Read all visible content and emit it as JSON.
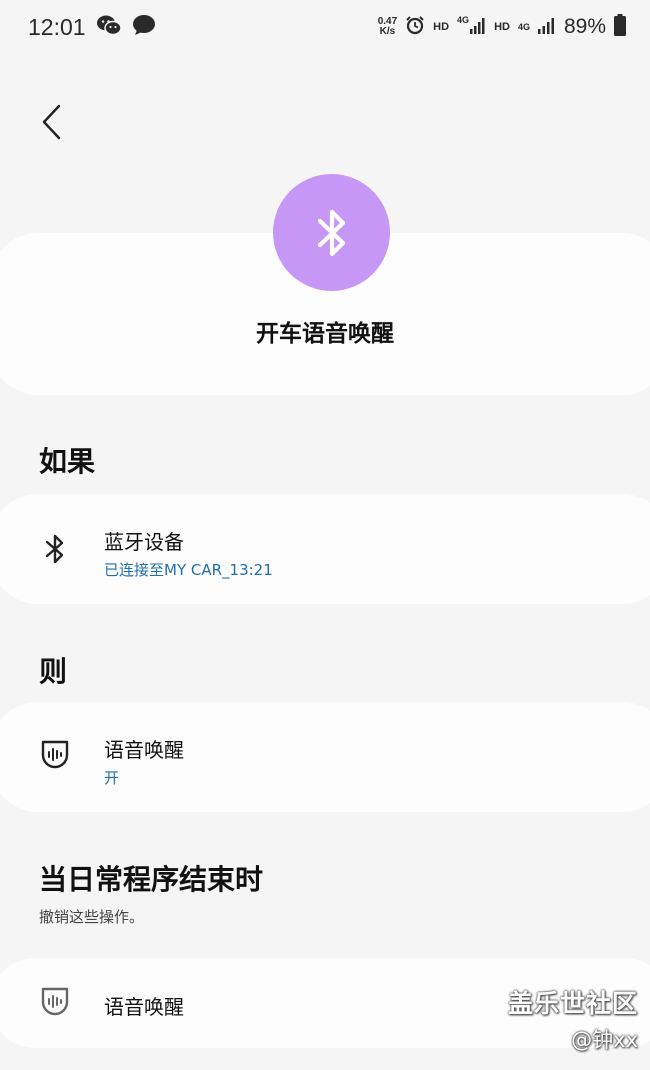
{
  "status_bar": {
    "time": "12:01",
    "netspeed_value": "0.47",
    "netspeed_unit": "K/s",
    "hd1": "HD",
    "net1": "4G",
    "hd2": "HD",
    "net2": "4G",
    "battery": "89%"
  },
  "header": {
    "title": "开车语音唤醒",
    "icon": "bluetooth-icon",
    "accent_color": "#c797f5"
  },
  "if_section": {
    "heading": "如果",
    "card": {
      "title": "蓝牙设备",
      "subtitle": "已连接至MY CAR_13:21",
      "icon": "bluetooth-icon"
    }
  },
  "then_section": {
    "heading": "则",
    "card": {
      "title": "语音唤醒",
      "subtitle": "开",
      "icon": "voice-wakeup-icon"
    }
  },
  "end_section": {
    "heading": "当日常程序结束时",
    "description": "撤销这些操作。",
    "card": {
      "title": "语音唤醒",
      "icon": "voice-wakeup-icon"
    }
  },
  "watermark": {
    "site": "盖乐世社区",
    "user": "@钟xx"
  },
  "colors": {
    "background": "#f5f5f5",
    "card": "#fdfdfd",
    "link_blue": "#1f6fad"
  }
}
